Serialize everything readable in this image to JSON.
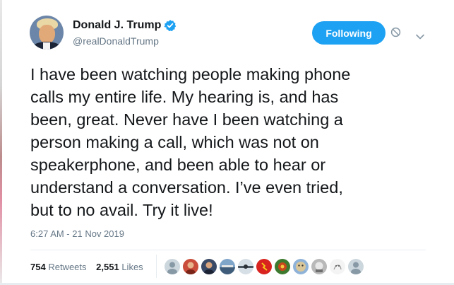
{
  "author": {
    "display_name": "Donald J. Trump",
    "handle": "@realDonaldTrump",
    "verified": true
  },
  "header": {
    "follow_label": "Following",
    "icons": [
      "verified-badge-icon",
      "block-icon",
      "chevron-down-icon"
    ]
  },
  "tweet": {
    "text": "I have been watching people making phone\ncalls my entire life. My hearing is, and has\nbeen, great. Never have I been watching a\nperson making a call, which was not on\nspeakerphone, and been able to hear or\nunderstand a conversation. I’ve even tried,\nbut to no avail. Try it live!",
    "timestamp": "6:27 AM - 21 Nov 2019"
  },
  "stats": {
    "retweets_count": "754",
    "retweets_label": "Retweets",
    "likes_count": "2,551",
    "likes_label": "Likes"
  },
  "likers": [
    "liker-avatar",
    "liker-avatar",
    "liker-avatar",
    "liker-avatar",
    "liker-avatar",
    "liker-avatar",
    "liker-avatar",
    "liker-avatar",
    "liker-avatar",
    "liker-avatar",
    "liker-avatar"
  ],
  "colors": {
    "accent": "#1da1f2",
    "text": "#14171a",
    "secondary_text": "#657786",
    "divider": "#e6ecf0"
  }
}
